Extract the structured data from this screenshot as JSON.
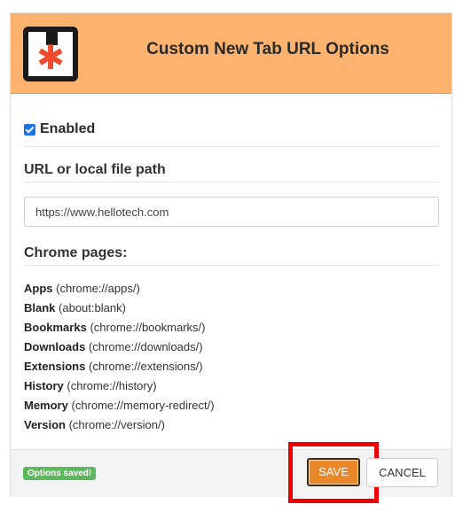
{
  "header": {
    "title": "Custom New Tab URL Options",
    "logo_icon": "asterisk-document-icon"
  },
  "enabled": {
    "checked": true,
    "label": "Enabled"
  },
  "url_section": {
    "heading": "URL or local file path",
    "value": "https://www.hellotech.com"
  },
  "chrome_pages": {
    "heading": "Chrome pages:",
    "items": [
      {
        "name": "Apps",
        "url": "(chrome://apps/)"
      },
      {
        "name": "Blank",
        "url": "(about:blank)"
      },
      {
        "name": "Bookmarks",
        "url": "(chrome://bookmarks/)"
      },
      {
        "name": "Downloads",
        "url": "(chrome://downloads/)"
      },
      {
        "name": "Extensions",
        "url": "(chrome://extensions/)"
      },
      {
        "name": "History",
        "url": "(chrome://history)"
      },
      {
        "name": "Memory",
        "url": "(chrome://memory-redirect/)"
      },
      {
        "name": "Version",
        "url": "(chrome://version/)"
      }
    ]
  },
  "footer": {
    "status": "Options saved!",
    "save_label": "SAVE",
    "cancel_label": "CANCEL"
  },
  "colors": {
    "header_bg": "#fbb36f",
    "save_bg": "#e8882a",
    "status_bg": "#5cb85c",
    "highlight": "#ee0000",
    "logo_star": "#f04a2f"
  }
}
